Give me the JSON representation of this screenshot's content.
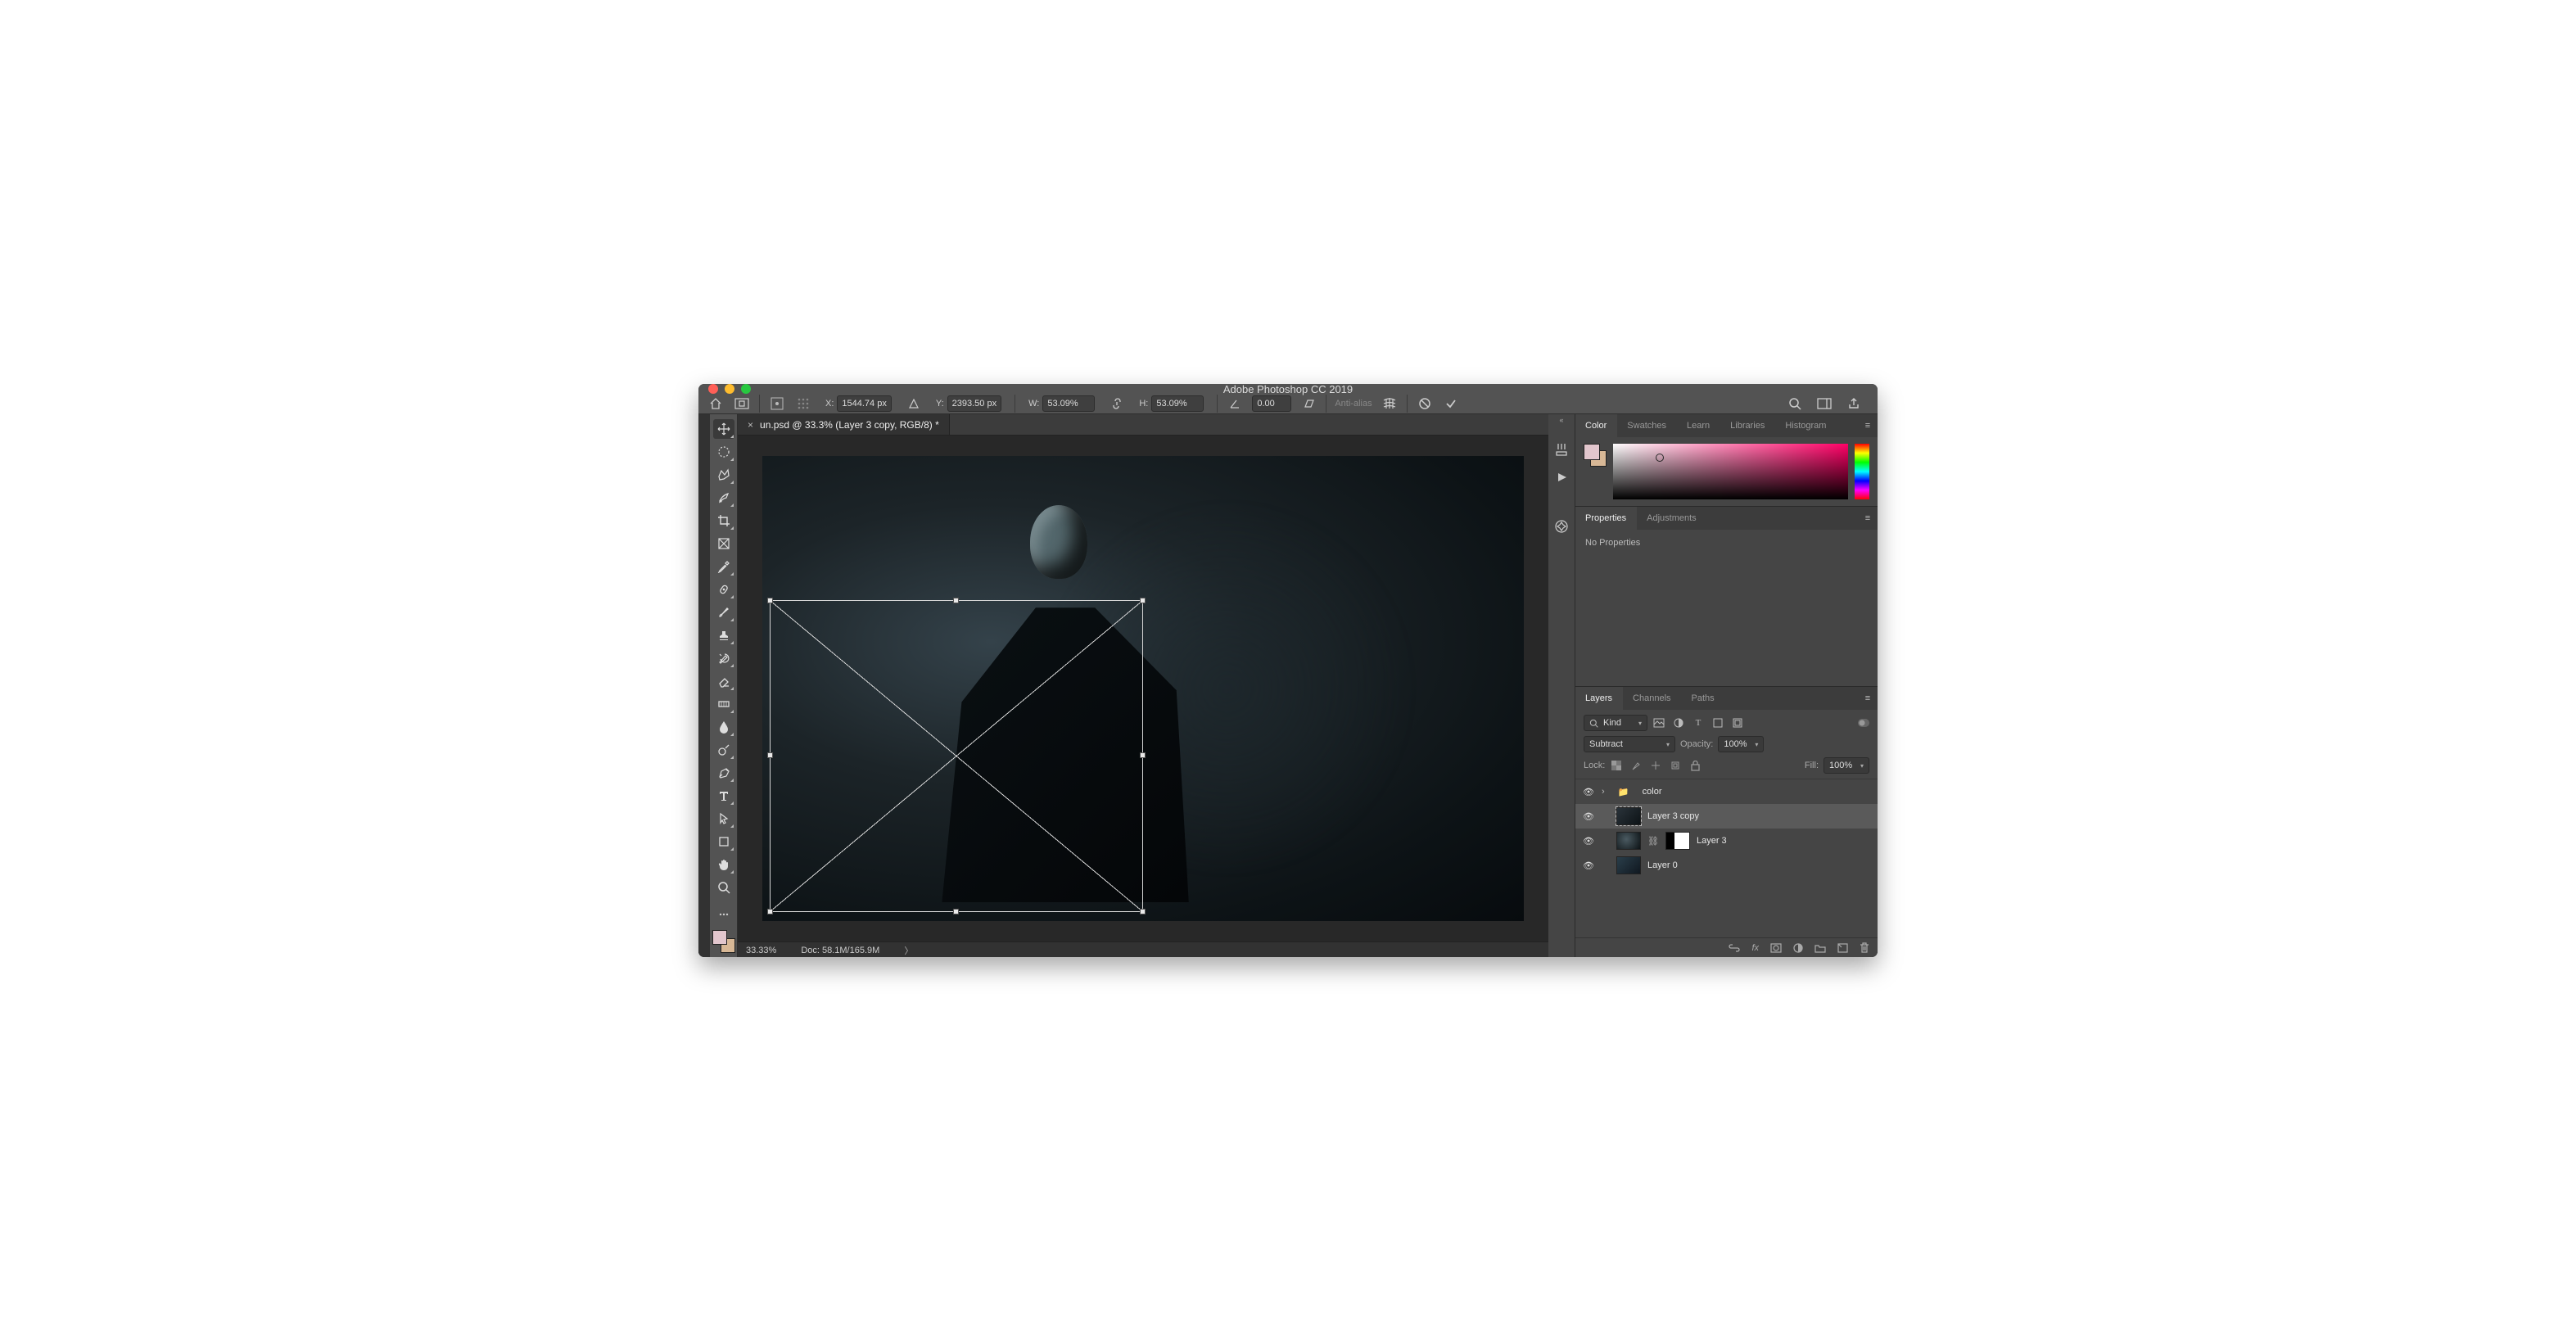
{
  "title": "Adobe Photoshop CC 2019",
  "options": {
    "x_label": "X:",
    "x": "1544.74 px",
    "y_label": "Y:",
    "y": "2393.50 px",
    "w_label": "W:",
    "w": "53.09%",
    "h_label": "H:",
    "h": "53.09%",
    "angle_label": "",
    "angle": "0.00",
    "antialias": "Anti-alias"
  },
  "document": {
    "tab": "un.psd @ 33.3% (Layer 3 copy, RGB/8) *",
    "zoom": "33.33%",
    "docsize": "Doc: 58.1M/165.9M"
  },
  "panels": {
    "colorTabs": [
      "Color",
      "Swatches",
      "Learn",
      "Libraries",
      "Histogram"
    ],
    "propTabs": [
      "Properties",
      "Adjustments"
    ],
    "noprops": "No Properties",
    "layerTabs": [
      "Layers",
      "Channels",
      "Paths"
    ]
  },
  "layersPanel": {
    "kind": "Kind",
    "blend": "Subtract",
    "opacityLabel": "Opacity:",
    "opacity": "100%",
    "lockLabel": "Lock:",
    "fillLabel": "Fill:",
    "fill": "100%",
    "items": [
      {
        "name": "color",
        "type": "group"
      },
      {
        "name": "Layer 3 copy",
        "type": "layer",
        "selected": true
      },
      {
        "name": "Layer 3",
        "type": "layer",
        "masked": true
      },
      {
        "name": "Layer 0",
        "type": "layer"
      }
    ]
  }
}
